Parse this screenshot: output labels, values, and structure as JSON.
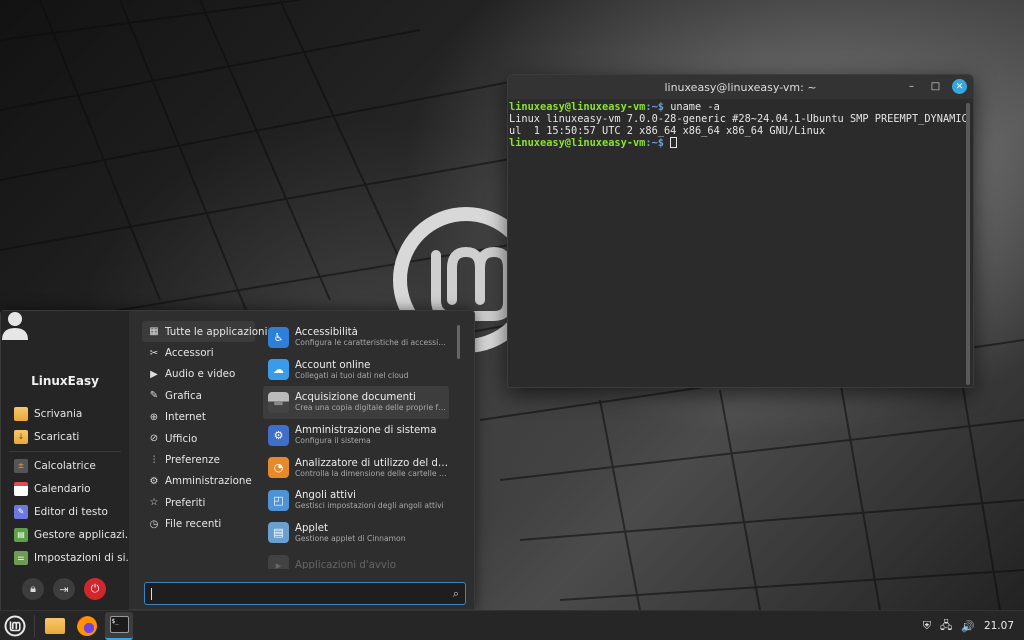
{
  "terminal": {
    "title": "linuxeasy@linuxeasy-vm: ~",
    "lines": [
      {
        "prompt": "linuxeasy@linuxeasy-vm",
        "cwd": ":~$",
        "cmd": " uname -a"
      },
      {
        "text": "Linux linuxeasy-vm 7.0.0-28-generic #28~24.04.1-Ubuntu SMP PREEMPT_DYNAMIC Wed J"
      },
      {
        "text": "ul  1 15:50:57 UTC 2 x86_64 x86_64 x86_64 GNU/Linux"
      },
      {
        "prompt": "linuxeasy@linuxeasy-vm",
        "cwd": ":~$",
        "cmd": " "
      }
    ],
    "buttons": {
      "minimize": "–",
      "maximize": "□",
      "close": "✕"
    }
  },
  "menu": {
    "username": "LinuxEasy",
    "places": [
      {
        "label": "Scrivania",
        "icon": "folder-icon"
      },
      {
        "label": "Scaricati",
        "icon": "downloads-folder-icon"
      }
    ],
    "favorites": [
      {
        "label": "Calcolatrice",
        "icon": "calculator-icon",
        "color": "#555555"
      },
      {
        "label": "Calendario",
        "icon": "calendar-icon",
        "color": "#e04b4b"
      },
      {
        "label": "Editor di testo",
        "icon": "text-editor-icon",
        "color": "#6c7ae0"
      },
      {
        "label": "Gestore applicazi...",
        "icon": "software-manager-icon",
        "color": "#5ea047"
      },
      {
        "label": "Impostazioni di si...",
        "icon": "system-settings-icon",
        "color": "#6f9b54"
      }
    ],
    "session": {
      "lock": "🔒",
      "logout": "⏻",
      "power": "⏻"
    },
    "categories": [
      {
        "label": "Tutte le applicazioni",
        "icon": "grid-icon",
        "glyph": "▦"
      },
      {
        "label": "Accessori",
        "icon": "tools-icon",
        "glyph": "✂"
      },
      {
        "label": "Audio e video",
        "icon": "media-icon",
        "glyph": "▶"
      },
      {
        "label": "Grafica",
        "icon": "graphics-icon",
        "glyph": "✎"
      },
      {
        "label": "Internet",
        "icon": "globe-icon",
        "glyph": "⊕"
      },
      {
        "label": "Ufficio",
        "icon": "paperclip-icon",
        "glyph": "⊘"
      },
      {
        "label": "Preferenze",
        "icon": "sliders-icon",
        "glyph": "⫶"
      },
      {
        "label": "Amministrazione",
        "icon": "gear-icon",
        "glyph": "⚙"
      },
      {
        "label": "Preferiti",
        "icon": "star-icon",
        "glyph": "☆"
      },
      {
        "label": "File recenti",
        "icon": "clock-icon",
        "glyph": "◷"
      }
    ],
    "apps": [
      {
        "name": "Accessibilità",
        "desc": "Configura le caratteristiche di accessibilità",
        "icon": "accessibility-icon",
        "color": "#2f7fd8",
        "glyph": "♿"
      },
      {
        "name": "Account online",
        "desc": "Collegati ai tuoi dati nel cloud",
        "icon": "cloud-icon",
        "color": "#3a9be8",
        "glyph": "☁"
      },
      {
        "name": "Acquisizione documenti",
        "desc": "Crea una copia digitale delle proprie foto...",
        "icon": "scanner-icon",
        "color": "#5a5a5a",
        "glyph": "▬"
      },
      {
        "name": "Amministrazione di sistema",
        "desc": "Configura il sistema",
        "icon": "admin-gear-icon",
        "color": "#3f6fc9",
        "glyph": "⚙"
      },
      {
        "name": "Analizzatore di utilizzo del disco",
        "desc": "Controlla la dimensione delle cartelle e lo...",
        "icon": "disk-usage-icon",
        "color": "#e58a2b",
        "glyph": "◔"
      },
      {
        "name": "Angoli attivi",
        "desc": "Gestisci impostazioni degli angoli attivi",
        "icon": "hot-corners-icon",
        "color": "#4f93d6",
        "glyph": "◰"
      },
      {
        "name": "Applet",
        "desc": "Gestione applet di Cinnamon",
        "icon": "applet-icon",
        "color": "#6aa0cf",
        "glyph": "▤"
      },
      {
        "name": "Applicazioni d'avvio",
        "desc": "",
        "icon": "startup-apps-icon",
        "color": "#777777",
        "glyph": "▸"
      }
    ],
    "search": {
      "value": "",
      "icon": "search-icon"
    }
  },
  "taskbar": {
    "tray": {
      "shield": "⛨",
      "network": "🖧",
      "volume": "🔊",
      "time": "21.07"
    }
  }
}
